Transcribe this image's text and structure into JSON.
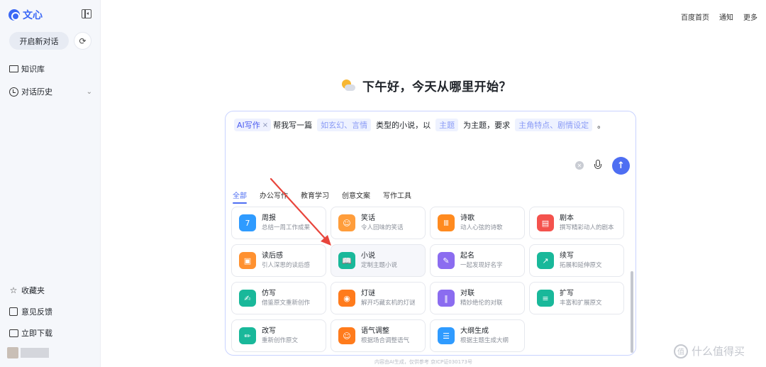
{
  "app": {
    "logo_text": "文心",
    "brand_color": "#3b68f5"
  },
  "sidebar": {
    "new_chat_label": "开启新对话",
    "items": [
      {
        "label": "知识库",
        "icon": "folder-icon"
      },
      {
        "label": "对话历史",
        "icon": "clock-icon"
      }
    ],
    "bottom_items": [
      {
        "label": "收藏夹",
        "icon": "star-icon"
      },
      {
        "label": "意见反馈",
        "icon": "feedback-icon"
      },
      {
        "label": "立即下载",
        "icon": "download-icon"
      }
    ]
  },
  "top_links": [
    "百度首页",
    "通知",
    "更多"
  ],
  "greeting": {
    "text": "下午好，今天从哪里开始？",
    "icon": "weather-icon"
  },
  "prompt": {
    "tag": "AI写作",
    "parts": [
      "帮我写一篇",
      "如玄幻、言情",
      "类型的小说，以",
      "主题",
      "为主题，要求",
      "主角特点、剧情设定",
      "。"
    ]
  },
  "tabs": [
    "全部",
    "办公写作",
    "教育学习",
    "创意文案",
    "写作工具"
  ],
  "active_tab": 0,
  "cards": [
    {
      "title": "周报",
      "subtitle": "总结一周工作成果",
      "icon": "calendar-icon",
      "color": "#2f9bff",
      "glyph": "7"
    },
    {
      "title": "笑话",
      "subtitle": "令人回味的笑话",
      "icon": "smile-icon",
      "color": "#ff9d3b",
      "glyph": "☺"
    },
    {
      "title": "诗歌",
      "subtitle": "动人心弦的诗歌",
      "icon": "poem-icon",
      "color": "#ff8a1f",
      "glyph": "Ⅲ"
    },
    {
      "title": "剧本",
      "subtitle": "撰写精彩动人的剧本",
      "icon": "clapper-icon",
      "color": "#f4524d",
      "glyph": "▤"
    },
    {
      "title": "读后感",
      "subtitle": "引人深思的读后感",
      "icon": "notes-icon",
      "color": "#ff9130",
      "glyph": "▣"
    },
    {
      "title": "小说",
      "subtitle": "定制主题小说",
      "icon": "book-icon",
      "color": "#19b89a",
      "glyph": "📖"
    },
    {
      "title": "起名",
      "subtitle": "一起发现好名字",
      "icon": "name-card-icon",
      "color": "#8b6cf0",
      "glyph": "✎"
    },
    {
      "title": "续写",
      "subtitle": "拓展和延伸原文",
      "icon": "continue-write-icon",
      "color": "#19b89a",
      "glyph": "↗"
    },
    {
      "title": "仿写",
      "subtitle": "借鉴原文重新创作",
      "icon": "imitate-icon",
      "color": "#19b89a",
      "glyph": "✍"
    },
    {
      "title": "灯谜",
      "subtitle": "解开巧藏玄机的灯谜",
      "icon": "lantern-icon",
      "color": "#ff7b1c",
      "glyph": "◉"
    },
    {
      "title": "对联",
      "subtitle": "精妙绝伦的对联",
      "icon": "couplet-icon",
      "color": "#8b6cf0",
      "glyph": "‖"
    },
    {
      "title": "扩写",
      "subtitle": "丰富和扩展原文",
      "icon": "expand-icon",
      "color": "#19b89a",
      "glyph": "≡"
    },
    {
      "title": "改写",
      "subtitle": "重新创作原文",
      "icon": "rewrite-icon",
      "color": "#19b89a",
      "glyph": "✏"
    },
    {
      "title": "语气调整",
      "subtitle": "根据场合调整语气",
      "icon": "tone-icon",
      "color": "#ff7b1c",
      "glyph": "☺"
    },
    {
      "title": "大纲生成",
      "subtitle": "根据主题生成大纲",
      "icon": "outline-icon",
      "color": "#2f9bff",
      "glyph": "☰"
    }
  ],
  "footer_note": "内容由AI生成，仅供参考 京ICP证030173号",
  "watermark": "什么值得买"
}
